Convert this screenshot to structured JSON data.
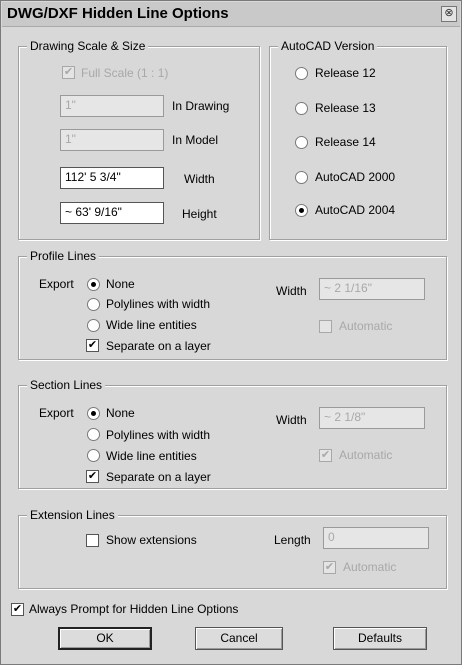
{
  "window": {
    "title": "DWG/DXF Hidden Line Options",
    "close_glyph": "⊗"
  },
  "scale_group": {
    "legend": "Drawing Scale & Size",
    "full_scale_label": "Full Scale (1 : 1)",
    "full_scale_checked": true,
    "in_drawing_value": "1\"",
    "in_drawing_label": "In Drawing",
    "in_model_value": "1\"",
    "in_model_label": "In Model",
    "width_value": "112' 5 3/4\"",
    "width_label": "Width",
    "height_value": "~ 63' 9/16\"",
    "height_label": "Height"
  },
  "autocad_group": {
    "legend": "AutoCAD Version",
    "options": [
      "Release 12",
      "Release 13",
      "Release 14",
      "AutoCAD 2000",
      "AutoCAD 2004"
    ],
    "selected": "AutoCAD 2004"
  },
  "profile_group": {
    "legend": "Profile Lines",
    "export_label": "Export",
    "options": [
      "None",
      "Polylines with width",
      "Wide line entities"
    ],
    "selected": "None",
    "separate_label": "Separate on a layer",
    "separate_checked": true,
    "width_label": "Width",
    "width_value": "~ 2 1/16\"",
    "automatic_label": "Automatic",
    "automatic_checked": false
  },
  "section_group": {
    "legend": "Section Lines",
    "export_label": "Export",
    "options": [
      "None",
      "Polylines with width",
      "Wide line entities"
    ],
    "selected": "None",
    "separate_label": "Separate on a layer",
    "separate_checked": true,
    "width_label": "Width",
    "width_value": "~ 2 1/8\"",
    "automatic_label": "Automatic",
    "automatic_checked": true
  },
  "extension_group": {
    "legend": "Extension Lines",
    "show_label": "Show extensions",
    "show_checked": false,
    "length_label": "Length",
    "length_value": "0",
    "automatic_label": "Automatic",
    "automatic_checked": true
  },
  "always_prompt": {
    "label": "Always Prompt for Hidden Line Options",
    "checked": true
  },
  "buttons": {
    "ok": "OK",
    "cancel": "Cancel",
    "defaults": "Defaults"
  },
  "check_glyph": "✔"
}
